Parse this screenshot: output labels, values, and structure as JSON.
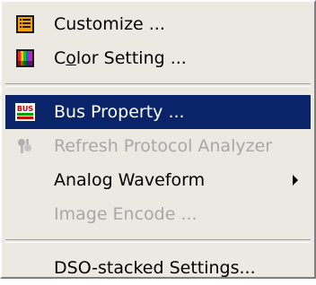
{
  "menu": {
    "items": [
      {
        "label": "Customize ...",
        "icon": "customize-icon"
      },
      {
        "label_prefix": "C",
        "label_underlined": "o",
        "label_suffix": "lor Setting ...",
        "icon": "color-setting-icon"
      },
      {
        "label": "Bus Property ...",
        "icon": "bus-property-icon",
        "icon_text": "BUS",
        "selected": true
      },
      {
        "label": "Refresh Protocol Analyzer",
        "icon": "refresh-protocol-icon",
        "disabled": true
      },
      {
        "label": "Analog Waveform",
        "submenu": true
      },
      {
        "label": "Image Encode ...",
        "disabled": true
      },
      {
        "label": "DSO-stacked Settings..."
      }
    ]
  },
  "colors": {
    "menu_background": "#ece9e2",
    "selection": "#0a246a",
    "disabled_text": "#a8a8a8"
  }
}
